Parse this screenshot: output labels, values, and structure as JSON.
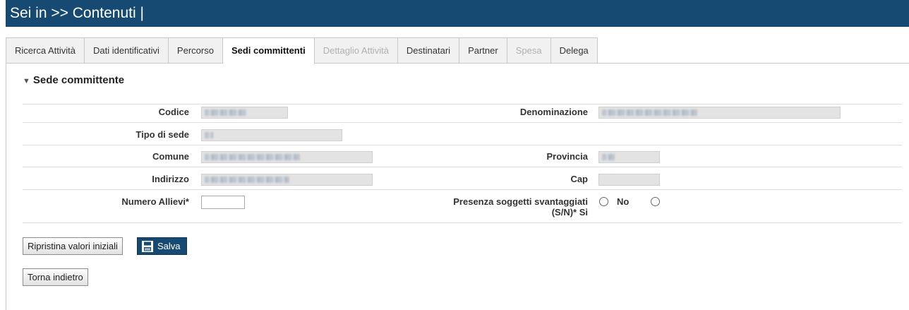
{
  "header": {
    "title": "Sei in >> Contenuti |"
  },
  "tabs": [
    {
      "label": "Ricerca Attività",
      "state": "normal"
    },
    {
      "label": "Dati identificativi",
      "state": "normal"
    },
    {
      "label": "Percorso",
      "state": "normal"
    },
    {
      "label": "Sedi committenti",
      "state": "active"
    },
    {
      "label": "Dettaglio Attività",
      "state": "disabled"
    },
    {
      "label": "Destinatari",
      "state": "normal"
    },
    {
      "label": "Partner",
      "state": "normal"
    },
    {
      "label": "Spesa",
      "state": "disabled"
    },
    {
      "label": "Delega",
      "state": "normal"
    }
  ],
  "section": {
    "title": "Sede committente",
    "toggle_icon": "triangle-down-icon"
  },
  "form": {
    "codice_label": "Codice",
    "denominazione_label": "Denominazione",
    "tipo_sede_label": "Tipo di sede",
    "comune_label": "Comune",
    "provincia_label": "Provincia",
    "indirizzo_label": "Indirizzo",
    "cap_label": "Cap",
    "numero_allievi_label": "Numero Allievi*",
    "numero_allievi_value": "",
    "presenza_label_line1": "Presenza soggetti svantaggiati",
    "presenza_label_line2": "(S/N)* Si",
    "presenza_option_no": "No"
  },
  "buttons": {
    "reset_label": "Ripristina valori iniziali",
    "save_label": "Salva",
    "save_icon": "floppy-disk-icon",
    "back_label": "Torna indietro"
  },
  "colors": {
    "header_bg": "#174a73",
    "save_bg": "#174a73"
  }
}
